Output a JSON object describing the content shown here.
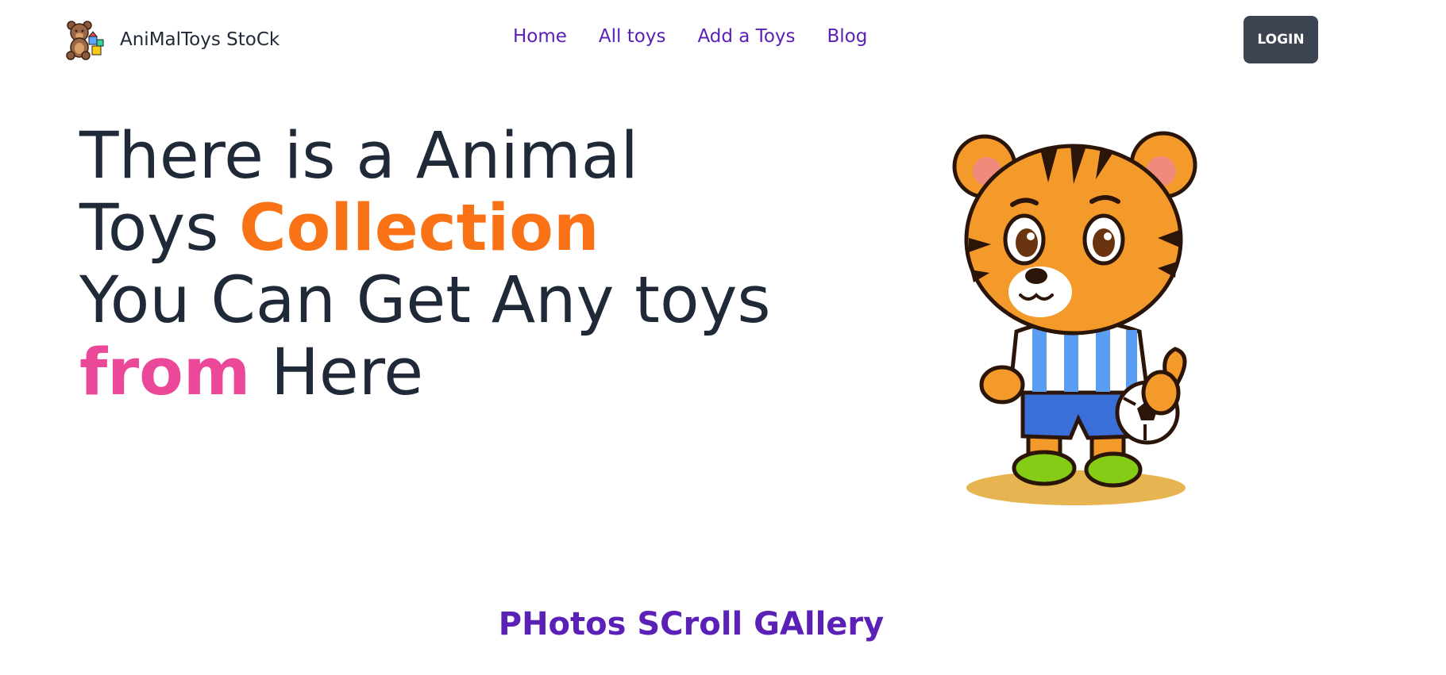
{
  "brand": {
    "name": "AniMalToys StoCk",
    "logo_icon": "teddy-bear-blocks-icon"
  },
  "nav": {
    "items": [
      {
        "label": "Home"
      },
      {
        "label": "All toys"
      },
      {
        "label": "Add a Toys"
      },
      {
        "label": "Blog"
      }
    ]
  },
  "header": {
    "login_label": "LOGIN"
  },
  "hero": {
    "line1": "There is a Animal",
    "line2_prefix": "Toys ",
    "line2_highlight": "Collection",
    "line3": "You Can Get Any toys",
    "line4_highlight": "from",
    "line4_suffix": " Here",
    "image_icon": "tiger-soccer-mascot-icon"
  },
  "gallery": {
    "title": "PHotos SCroll GAllery"
  },
  "colors": {
    "nav_link": "#5b21b6",
    "login_bg": "#3d4451",
    "text_dark": "#1f2937",
    "accent_orange": "#f97316",
    "accent_pink": "#ec4899"
  }
}
